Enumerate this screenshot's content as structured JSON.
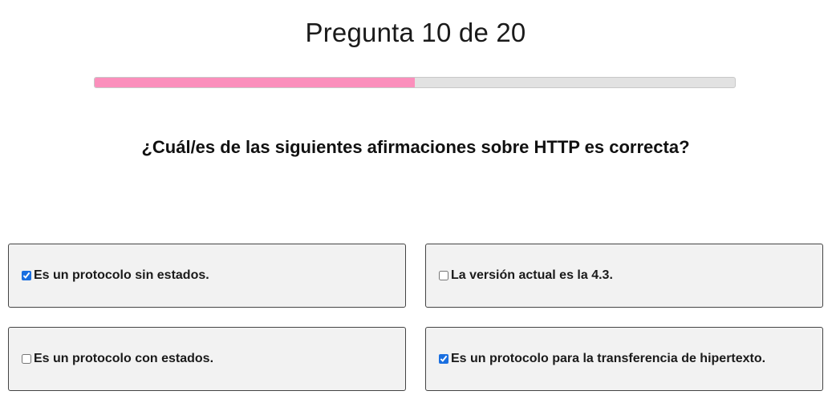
{
  "header": {
    "progress_label": "Pregunta 10 de 20",
    "progress_fraction": 0.5
  },
  "question": {
    "text": "¿Cuál/es de las siguientes afirmaciones sobre HTTP es correcta?"
  },
  "options": [
    {
      "label": "Es un protocolo sin estados.",
      "checked": true
    },
    {
      "label": "La versión actual es la 4.3.",
      "checked": false
    },
    {
      "label": "Es un protocolo con estados.",
      "checked": false
    },
    {
      "label": "Es un protocolo para la transferencia de hipertexto.",
      "checked": true
    }
  ],
  "colors": {
    "progress_fill": "#fb8fbc",
    "progress_track": "#e2e2e2",
    "option_background": "#f2f2f2",
    "checkbox_accent": "#1a6fe0"
  }
}
